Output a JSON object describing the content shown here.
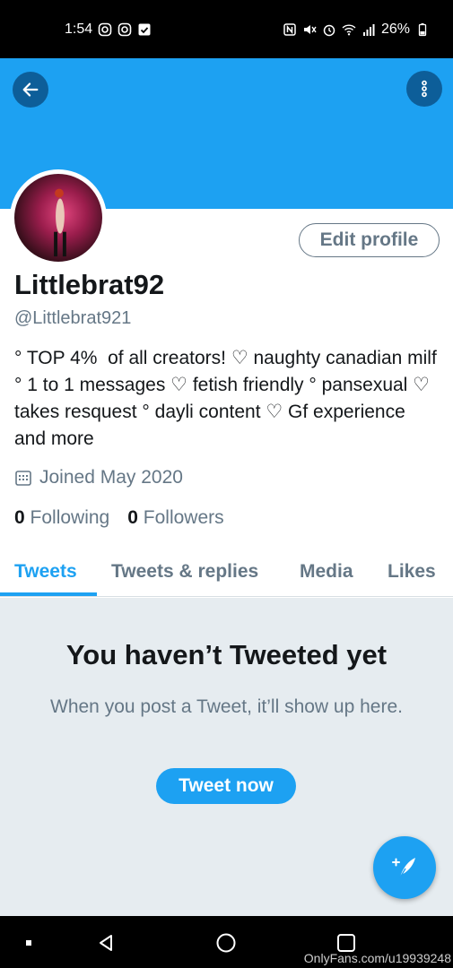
{
  "status_bar": {
    "time": "1:54",
    "battery": "26%",
    "left_icons": [
      "instagram-icon",
      "instagram-icon",
      "checkbox-icon"
    ],
    "right_icons": [
      "nfc-icon",
      "mute-icon",
      "alarm-icon",
      "wifi-icon",
      "signal-icon",
      "battery-icon"
    ]
  },
  "header": {
    "back_icon": "arrow-left-icon",
    "more_icon": "more-vertical-icon",
    "banner_color": "#1da1f2"
  },
  "profile": {
    "display_name": "Littlebrat92",
    "handle": "@Littlebrat921",
    "bio": "° TOP 4%  of all creators! ♡ naughty canadian milf ° 1 to 1 messages ♡ fetish friendly ° pansexual ♡ takes resquest ° dayli content ♡ Gf experience   and more",
    "joined": "Joined May 2020",
    "following_count": "0",
    "following_label": "Following",
    "followers_count": "0",
    "followers_label": "Followers",
    "edit_profile_label": "Edit profile"
  },
  "tabs": [
    {
      "label": "Tweets",
      "active": true
    },
    {
      "label": "Tweets & replies",
      "active": false
    },
    {
      "label": "Media",
      "active": false
    },
    {
      "label": "Likes",
      "active": false
    }
  ],
  "empty_state": {
    "title": "You haven’t Tweeted yet",
    "subtitle": "When you post a Tweet, it’ll show up here.",
    "button_label": "Tweet now"
  },
  "fab": {
    "icon": "compose-tweet-icon"
  },
  "nav_bar": {
    "items": [
      "recents-icon",
      "back-icon",
      "home-icon",
      "overview-icon"
    ],
    "watermark": "OnlyFans.com/u19939248"
  },
  "colors": {
    "accent": "#1da1f2",
    "secondary_text": "#657786",
    "empty_bg": "#e6ecf0"
  }
}
